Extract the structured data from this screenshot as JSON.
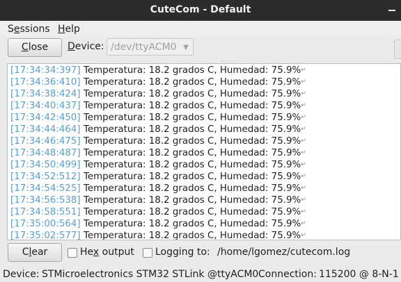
{
  "window": {
    "title": "CuteCom - Default"
  },
  "menu": {
    "sessions": "Sessions",
    "help": "Help"
  },
  "toolbar": {
    "close_label": "Close",
    "device_label": "Device:",
    "device_value": "/dev/ttyACM0"
  },
  "output": {
    "lines": [
      {
        "ts": "[17:34:34:397]",
        "msg": "Temperatura: 18.2 grados C, Humedad: 75.9%"
      },
      {
        "ts": "[17:34:36:410]",
        "msg": "Temperatura: 18.2 grados C, Humedad: 75.9%"
      },
      {
        "ts": "[17:34:38:424]",
        "msg": "Temperatura: 18.2 grados C, Humedad: 75.9%"
      },
      {
        "ts": "[17:34:40:437]",
        "msg": "Temperatura: 18.2 grados C, Humedad: 75.9%"
      },
      {
        "ts": "[17:34:42:450]",
        "msg": "Temperatura: 18.2 grados C, Humedad: 75.9%"
      },
      {
        "ts": "[17:34:44:464]",
        "msg": "Temperatura: 18.2 grados C, Humedad: 75.9%"
      },
      {
        "ts": "[17:34:46:475]",
        "msg": "Temperatura: 18.2 grados C, Humedad: 75.9%"
      },
      {
        "ts": "[17:34:48:487]",
        "msg": "Temperatura: 18.2 grados C, Humedad: 75.9%"
      },
      {
        "ts": "[17:34:50:499]",
        "msg": "Temperatura: 18.2 grados C, Humedad: 75.9%"
      },
      {
        "ts": "[17:34:52:512]",
        "msg": "Temperatura: 18.2 grados C, Humedad: 75.9%"
      },
      {
        "ts": "[17:34:54:525]",
        "msg": "Temperatura: 18.2 grados C, Humedad: 75.9%"
      },
      {
        "ts": "[17:34:56:538]",
        "msg": "Temperatura: 18.2 grados C, Humedad: 75.9%"
      },
      {
        "ts": "[17:34:58:551]",
        "msg": "Temperatura: 18.2 grados C, Humedad: 75.9%"
      },
      {
        "ts": "[17:35:00:564]",
        "msg": "Temperatura: 18.2 grados C, Humedad: 75.9%"
      },
      {
        "ts": "[17:35:02:577]",
        "msg": "Temperatura: 18.2 grados C, Humedad: 75.9%"
      }
    ]
  },
  "bottom": {
    "clear_label": "Clear",
    "hex_label": "Hex output",
    "logging_label": "Logging to:",
    "log_path": "/home/lgomez/cutecom.log"
  },
  "status": {
    "device_label": "Device:",
    "device_value": "STMicroelectronics STM32 STLink @ttyACM0",
    "connection_label": "Connection:",
    "connection_value": "115200 @ 8-N-1"
  },
  "colors": {
    "timestamp": "#5a9ec7",
    "titlebar": "#2c2c2c"
  }
}
